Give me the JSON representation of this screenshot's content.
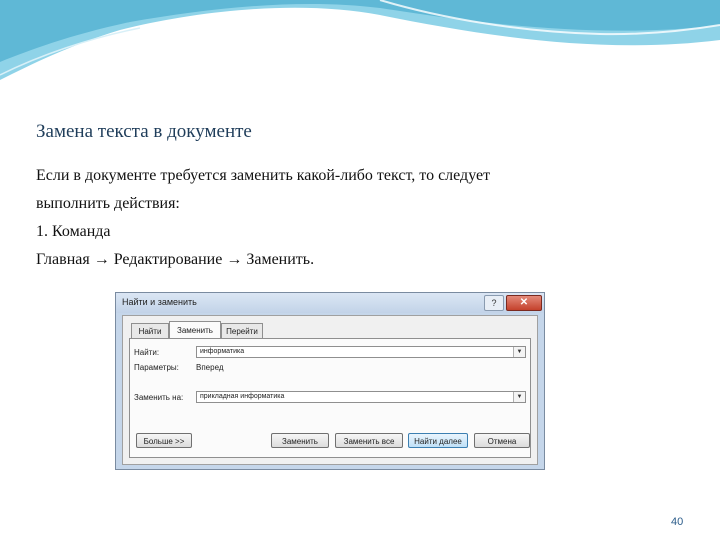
{
  "slide": {
    "title": "Замена текста в документе",
    "lines": [
      "Если в документе требуется заменить какой-либо текст, то следует",
      "выполнить действия:",
      "1. Команда",
      "Главная → Редактирование → Заменить."
    ],
    "page_number": "40"
  },
  "dialog": {
    "title": "Найти и заменить",
    "help_label": "?",
    "close_label": "✕",
    "tabs": [
      {
        "label": "Найти"
      },
      {
        "label": "Заменить"
      },
      {
        "label": "Перейти"
      }
    ],
    "find_label": "Найти:",
    "find_value": "информатика",
    "direction_label": "Параметры:",
    "direction_value": "Вперед",
    "replace_label": "Заменить на:",
    "replace_value": "прикладная информатика",
    "buttons": {
      "more": "Больше >>",
      "replace": "Заменить",
      "replace_all": "Заменить все",
      "find_next": "Найти далее",
      "cancel": "Отмена"
    }
  },
  "colors": {
    "title": "#1f3d5a",
    "wave": "#8fd3e8",
    "dialog_frame": "#c5d6ea",
    "page_number": "#2b5c8a"
  }
}
